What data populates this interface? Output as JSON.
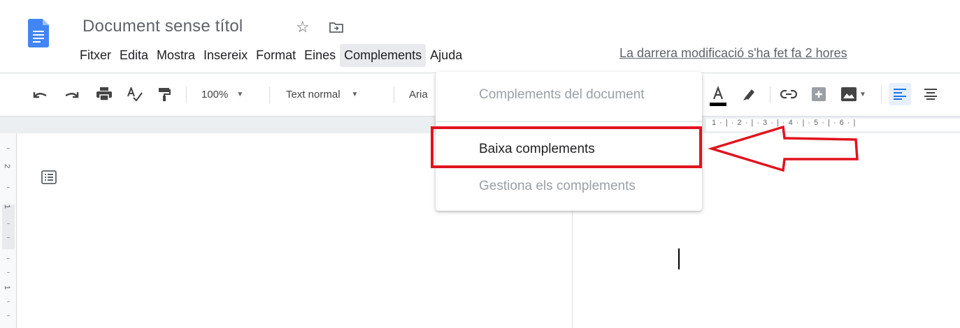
{
  "app": {
    "title": "Document sense títol",
    "icons": [
      "docs-logo-icon",
      "star-icon",
      "move-to-folder-icon"
    ]
  },
  "menubar": {
    "items": [
      "Fitxer",
      "Edita",
      "Mostra",
      "Insereix",
      "Format",
      "Eines",
      "Complements",
      "Ajuda"
    ],
    "active": "Complements",
    "last_modified": "La darrera modificació s'ha fet fa 2 hores"
  },
  "toolbar": {
    "zoom": "100%",
    "style": "Text normal",
    "font": "Aria",
    "icons": [
      "undo-icon",
      "redo-icon",
      "print-icon",
      "spellcheck-icon",
      "paint-format-icon",
      "text-color-icon",
      "highlight-icon",
      "link-icon",
      "comment-icon",
      "image-icon",
      "align-left-icon",
      "align-center-icon"
    ]
  },
  "ruler": {
    "numbers": "1 · | · 2 · | · 3 · | · 4 · | · 5 · | · 6 · |",
    "vertical_numbers": [
      "2",
      "1",
      "1"
    ]
  },
  "dropdown": {
    "items": [
      {
        "label": "Complements del document",
        "enabled": false
      },
      {
        "label": "Baixa complements",
        "enabled": true
      },
      {
        "label": "Gestiona els complements",
        "enabled": false
      }
    ]
  },
  "colors": {
    "docs_blue": "#4285f4",
    "annotation_red": "#e0141e",
    "active_align": "#e8f0fe"
  }
}
